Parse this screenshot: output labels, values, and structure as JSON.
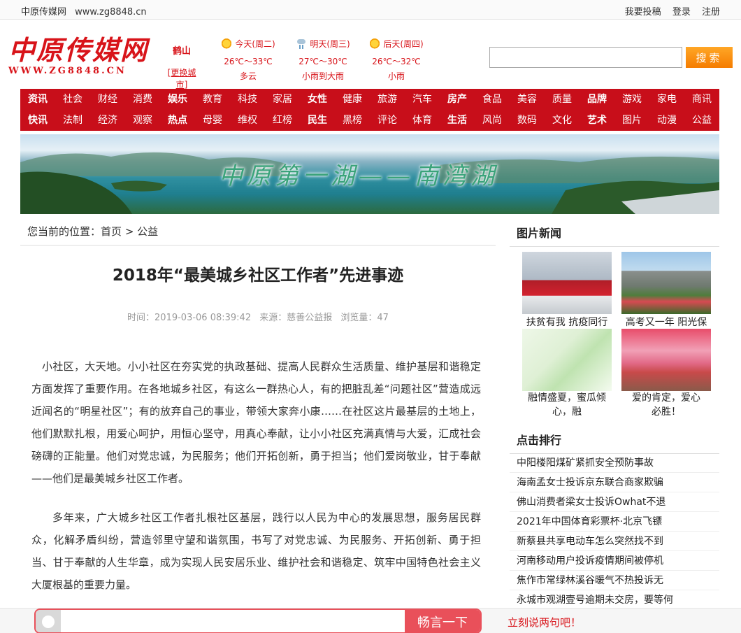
{
  "topbar": {
    "site_name": "中原传媒网",
    "site_url": "www.zg8848.cn",
    "links": [
      "我要投稿",
      "登录",
      "注册"
    ]
  },
  "logo": {
    "cn": "中原传媒网",
    "en": "WWW.ZG8848.CN"
  },
  "city": {
    "name": "鹤山",
    "change": "[更换城市]"
  },
  "weather": [
    {
      "day": "今天(周二)",
      "icon": "sunny-cloudy-icon",
      "temp": "26℃～33℃",
      "desc": "多云"
    },
    {
      "day": "明天(周三)",
      "icon": "rain-icon",
      "temp": "27℃～30℃",
      "desc": "小雨到大雨"
    },
    {
      "day": "后天(周四)",
      "icon": "sunny-cloudy-icon",
      "temp": "26℃～32℃",
      "desc": "小雨"
    }
  ],
  "search": {
    "placeholder": "",
    "button": "搜索"
  },
  "nav": {
    "row1": [
      "资讯",
      "社会",
      "财经",
      "消费",
      "娱乐",
      "教育",
      "科技",
      "家居",
      "女性",
      "健康",
      "旅游",
      "汽车",
      "房产",
      "食品",
      "美容",
      "质量",
      "品牌",
      "游戏",
      "家电",
      "商讯"
    ],
    "row2": [
      "快讯",
      "法制",
      "经济",
      "观察",
      "热点",
      "母婴",
      "维权",
      "红榜",
      "民生",
      "黑榜",
      "评论",
      "体育",
      "生活",
      "风尚",
      "数码",
      "文化",
      "艺术",
      "图片",
      "动漫",
      "公益"
    ]
  },
  "banner": {
    "title": "中原第一湖——南湾湖"
  },
  "breadcrumb": {
    "prefix": "您当前的位置：",
    "home": "首页",
    "sep": ">",
    "current": "公益"
  },
  "article": {
    "title": "2018年“最美城乡社区工作者”先进事迹",
    "meta": {
      "time": "时间：2019-03-06 08:39:42",
      "source": "来源：慈善公益报",
      "views": "浏览量：47"
    },
    "paragraphs": [
      "小社区，大天地。小小社区在夯实党的执政基础、提高人民群众生活质量、维护基层和谐稳定方面发挥了重要作用。在各地城乡社区，有这么一群热心人，有的把脏乱差“问题社区”营造成远近闻名的“明星社区”；有的放弃自己的事业，带领大家奔小康……在社区这片最基层的土地上，他们默默扎根，用爱心呵护，用恒心坚守，用真心奉献，让小小社区充满真情与大爱，汇成社会磅礴的正能量。他们对党忠诚，为民服务；他们开拓创新，勇于担当；他们爱岗敬业，甘于奉献——他们是最美城乡社区工作者。",
      "多年来，广大城乡社区工作者扎根社区基层，践行以人民为中心的发展思想，服务居民群众，化解矛盾纠纷，营造邻里守望和谐氛围，书写了对党忠诚、为民服务、开拓创新、勇于担当、甘于奉献的人生华章，成为实现人民安居乐业、维护社会和谐稳定、筑牢中国特色社会主义大厦根基的重要力量。"
    ]
  },
  "sidebar": {
    "pic_news_title": "图片新闻",
    "pics": [
      {
        "caption": "扶贫有我 抗疫同行"
      },
      {
        "caption": "高考又一年 阳光保"
      },
      {
        "caption": "融情盛夏，蜜瓜倾心，融"
      },
      {
        "caption": "爱的肯定，爱心必胜！"
      }
    ],
    "rank_title": "点击排行",
    "rank": [
      "中阳楼阳煤矿紧抓安全预防事故",
      "海南孟女士投诉京东联合商家欺骗",
      "佛山消费者梁女士投诉Owhat不退",
      "2021年中国体育彩票杯·北京飞镖",
      "新蔡县共享电动车怎么突然找不到",
      "河南移动用户投诉疫情期间被停机",
      "焦作市常绿林溪谷暖气不热投诉无",
      "永城市观湖壹号逾期未交房，要等何"
    ]
  },
  "comment_bar": {
    "button": "畅言一下",
    "prompt": "立刻说两句吧！"
  },
  "colors": {
    "brand_red": "#c80e1a",
    "search_orange": "#f57c00",
    "comment_red": "#e9505a"
  }
}
